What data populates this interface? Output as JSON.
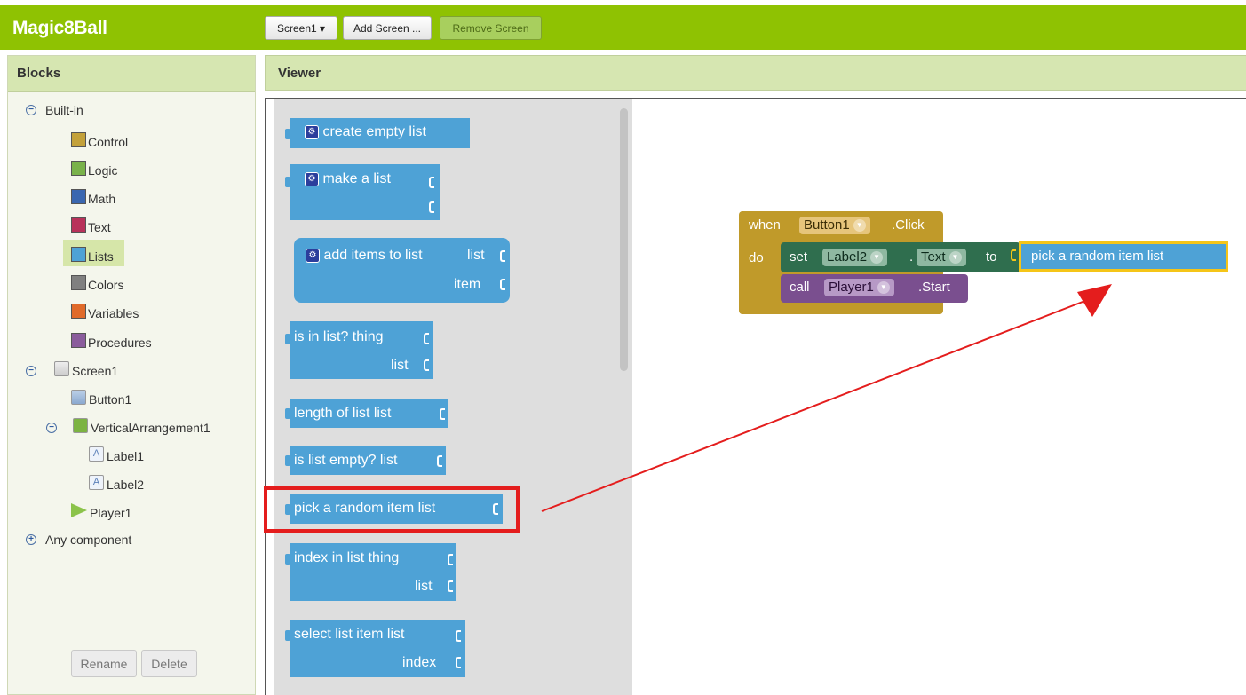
{
  "app": {
    "title": "Magic8Ball"
  },
  "toolbar": {
    "screen_select": "Screen1 ▾",
    "add_screen": "Add Screen ...",
    "remove_screen": "Remove Screen"
  },
  "blocks_panel": {
    "header": "Blocks",
    "builtin": "Built-in",
    "categories": [
      {
        "label": "Control",
        "color": "#c3a13a"
      },
      {
        "label": "Logic",
        "color": "#79b24a"
      },
      {
        "label": "Math",
        "color": "#3a67b0"
      },
      {
        "label": "Text",
        "color": "#b8325a"
      },
      {
        "label": "Lists",
        "color": "#4ea2d6"
      },
      {
        "label": "Colors",
        "color": "#808080"
      },
      {
        "label": "Variables",
        "color": "#e06a2a"
      },
      {
        "label": "Procedures",
        "color": "#8a5c9c"
      }
    ],
    "screen": "Screen1",
    "components": [
      "Button1",
      "VerticalArrangement1",
      "Label1",
      "Label2",
      "Player1"
    ],
    "any_component": "Any component",
    "rename": "Rename",
    "delete": "Delete"
  },
  "viewer": {
    "header": "Viewer"
  },
  "drawer": {
    "create_empty_list": "create empty list",
    "make_a_list": "make a list",
    "add_items": "add items to list",
    "add_items_list": "list",
    "add_items_item": "item",
    "is_in_list": "is in list? thing",
    "is_in_list_list": "list",
    "length_of_list": "length of list  list",
    "is_list_empty": "is list empty?  list",
    "pick_random": "pick a random item  list",
    "index_in_list": "index in list  thing",
    "index_in_list_list": "list",
    "select_list_item": "select list item  list",
    "select_list_item_index": "index"
  },
  "workspace": {
    "when": "when",
    "button": "Button1",
    "click": ".Click",
    "do": "do",
    "set": "set",
    "label": "Label2",
    "dot": ".",
    "text_prop": "Text",
    "to": "to",
    "pick": "pick a random item  list",
    "call": "call",
    "player": "Player1",
    "start": ".Start"
  },
  "colors": {
    "accent": "#8fc202",
    "lists": "#4ea2d6",
    "control": "#c09a2a",
    "set": "#2f6e4e",
    "call": "#7a4f8f",
    "highlight": "#e41d1d"
  }
}
